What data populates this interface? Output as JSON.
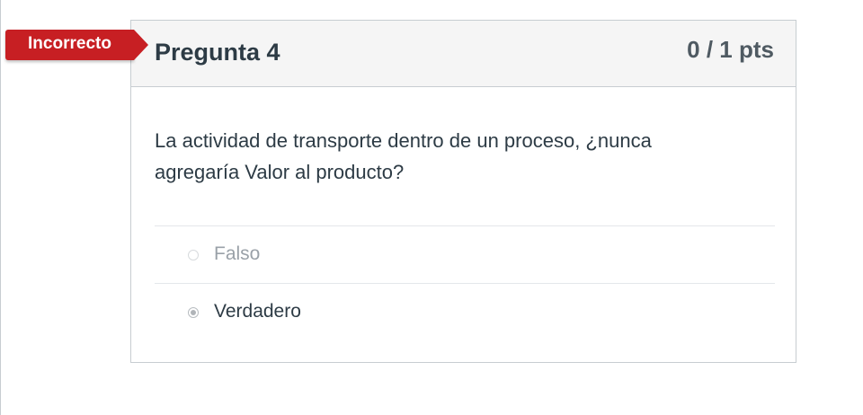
{
  "status_badge": {
    "label": "Incorrecto",
    "color": "#c71f23"
  },
  "question": {
    "title": "Pregunta 4",
    "points": "0 / 1 pts",
    "text": "La actividad de transporte dentro de un proceso, ¿nunca agregaría Valor al producto?",
    "answers": [
      {
        "label": "Falso",
        "selected": false
      },
      {
        "label": "Verdadero",
        "selected": true
      }
    ]
  }
}
